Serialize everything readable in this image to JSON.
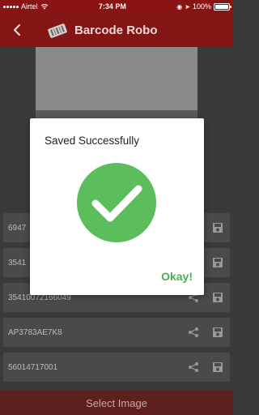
{
  "status_bar": {
    "carrier": "Airtel",
    "time": "7:34 PM",
    "battery_pct": "100%"
  },
  "app_bar": {
    "title": "Barcode Robo"
  },
  "barcode_list": [
    {
      "code": "6947"
    },
    {
      "code": "3541"
    },
    {
      "code": "35410072166049"
    },
    {
      "code": "AP3783AE7K8"
    },
    {
      "code": "56014717001"
    }
  ],
  "bottom": {
    "select_label": "Select Image"
  },
  "dialog": {
    "title": "Saved Successfully",
    "ok_label": "Okay!",
    "icon": "check-circle-icon",
    "accent": "#5cbd5c"
  },
  "colors": {
    "brand": "#851515",
    "status_bar": "#8a1313",
    "ok": "#4caf50"
  }
}
